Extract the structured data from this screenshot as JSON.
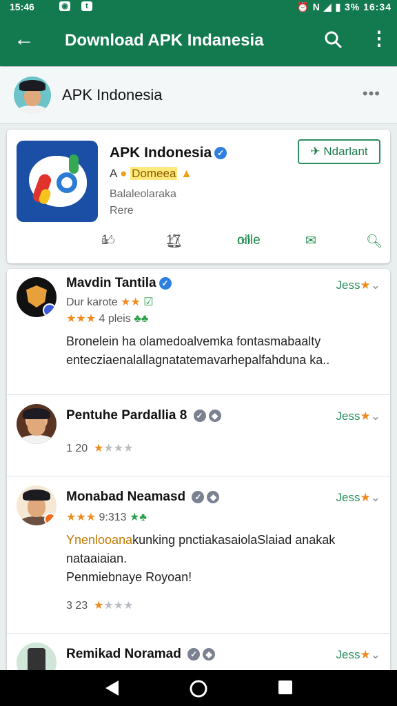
{
  "status_bar": {
    "time": "15:46",
    "right_text": "3% 16:34"
  },
  "toolbar": {
    "title": "Download APK Indanesia"
  },
  "channel": {
    "name": "APK  Indonesia"
  },
  "app": {
    "name": "APK Indonesia",
    "rating_prefix": "A",
    "rating_badge": "Domeea",
    "desc_line1": "Balaleolaraka",
    "desc_line2": "Rere",
    "download_label": "Ndarlant",
    "likes": "1",
    "bells": "17",
    "like_action": "oille"
  },
  "comments": [
    {
      "name": "Mavdin Tantila",
      "line1": "Dur karote",
      "line2": "4 pleis",
      "toggle": "Jess",
      "body": "Bronelein ha olamedoalvemka fontasmabaalty entecziaenalallagnatatemavarhepalfahduna ka.."
    },
    {
      "name": "Pentuhe Pardallia 8",
      "count": "1 20",
      "toggle": "Jess"
    },
    {
      "name": "Monabad Neamasd",
      "sub": "9:313",
      "toggle": "Jess",
      "body_highlight": "Ynenlooana",
      "body_rest": "kunking pnctiakasaiolaSlaiad anakak nataaiaian.",
      "body_line3": "Penmiebnaye Royoan!",
      "count": "3 23"
    },
    {
      "name": "Remikad Noramad",
      "toggle": "Jess"
    }
  ],
  "colors": {
    "primary": "#137a50",
    "accent": "#2a8f5e",
    "star": "#f08a1c"
  }
}
